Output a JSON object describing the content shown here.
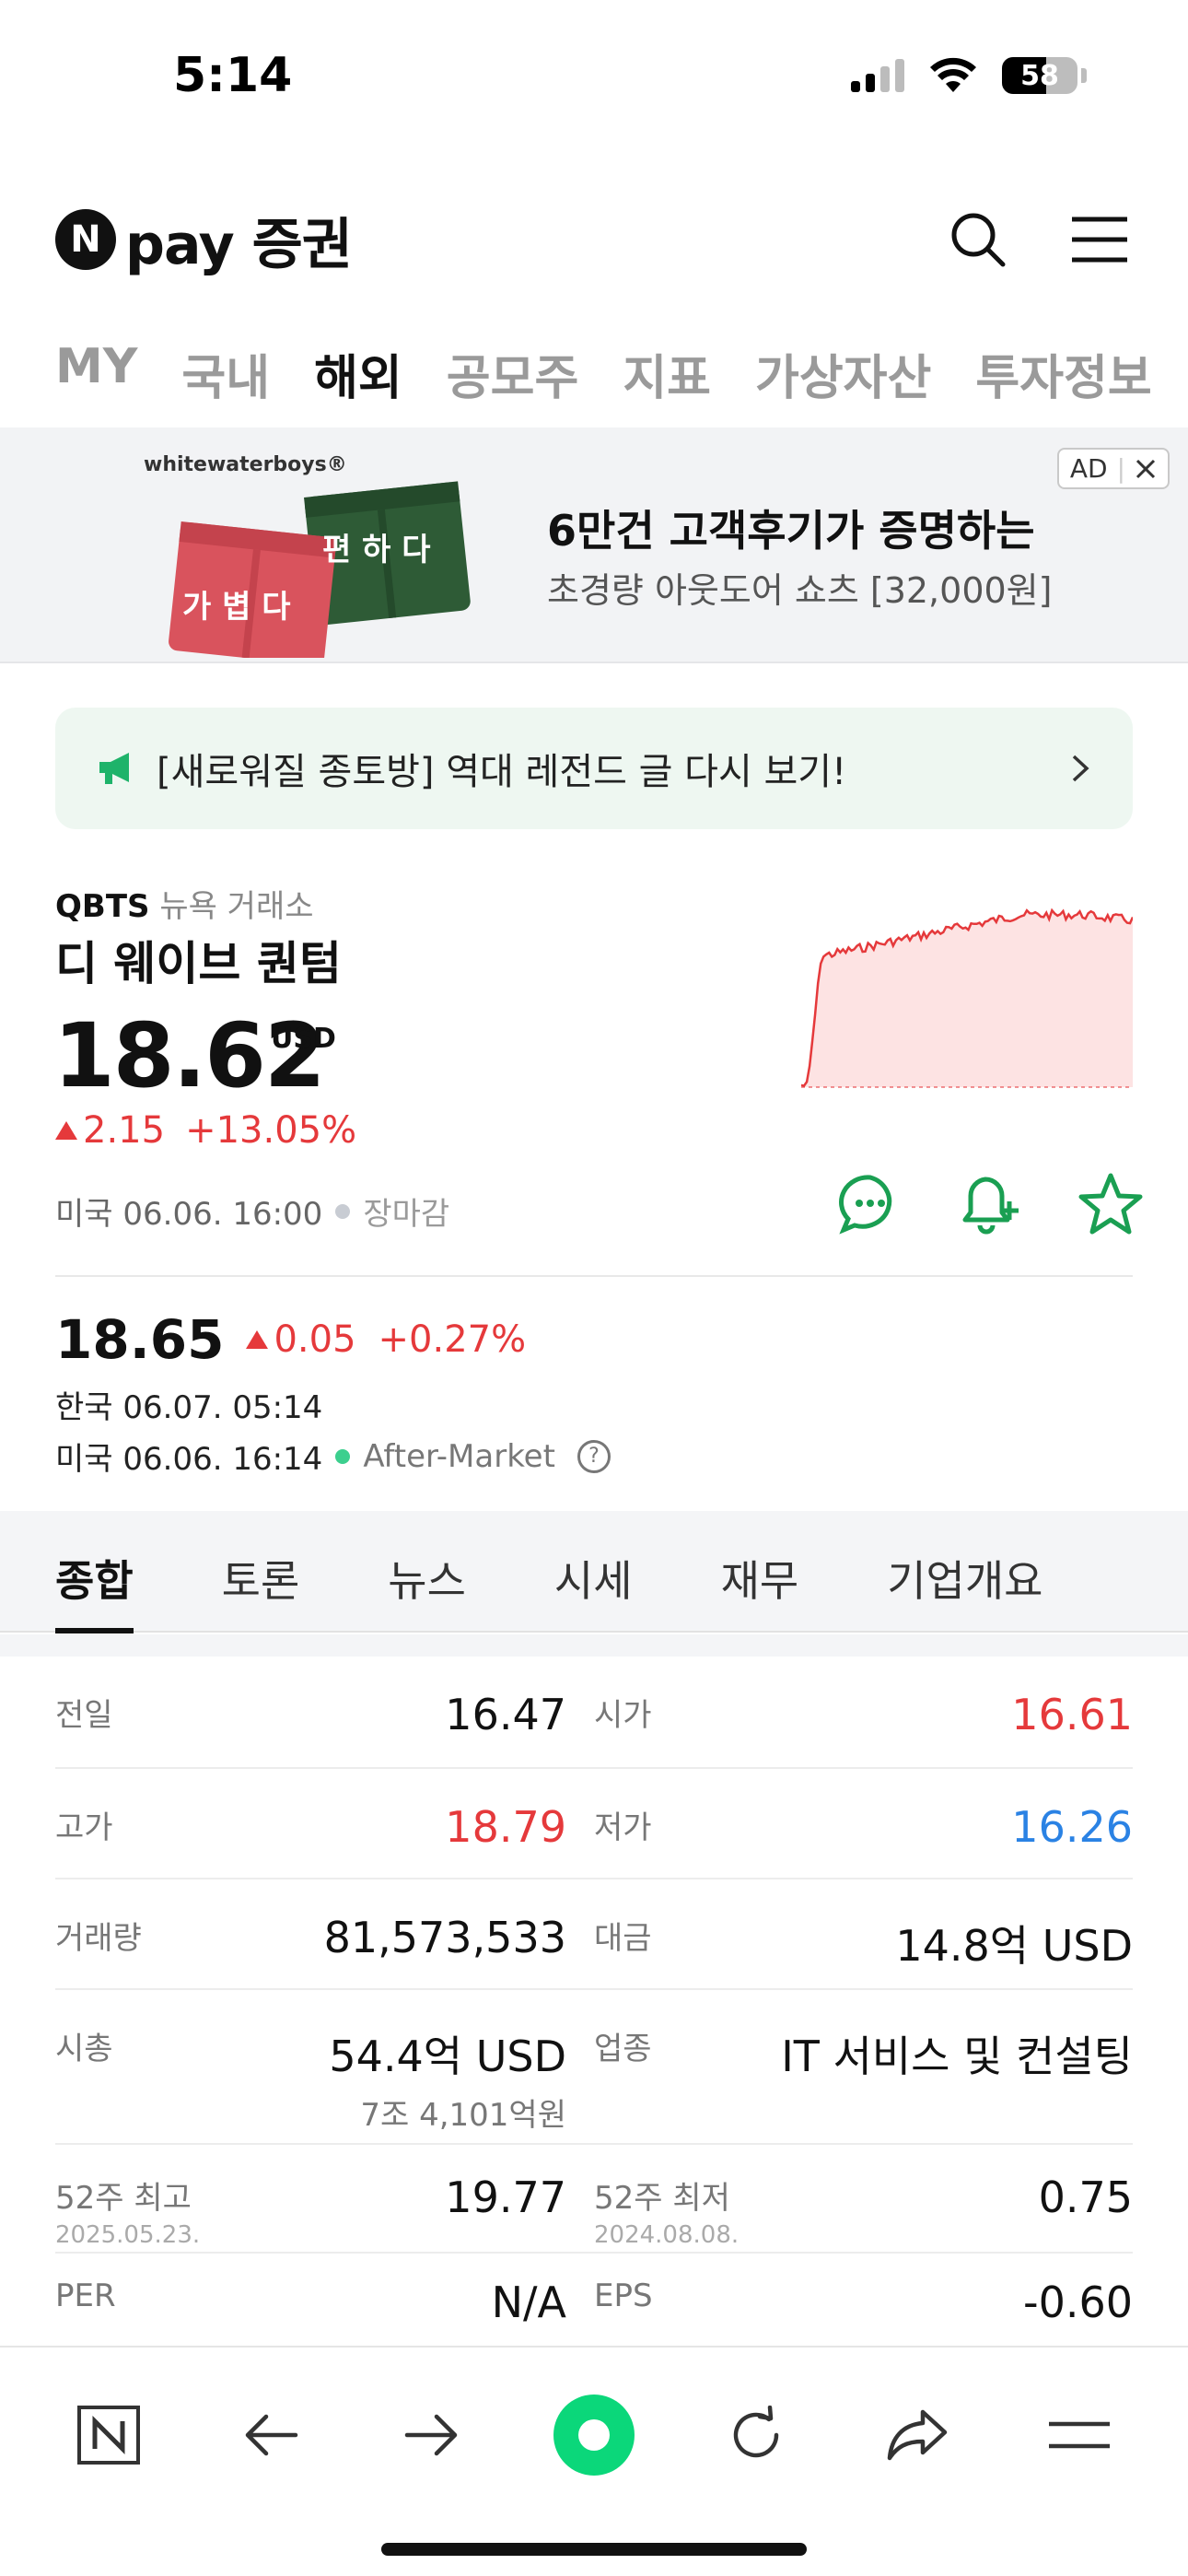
{
  "status": {
    "time": "5:14",
    "battery": "58"
  },
  "header": {
    "logo_letter": "N",
    "logo_text": "pay 증권"
  },
  "topnav": [
    "MY",
    "국내",
    "해외",
    "공모주",
    "지표",
    "가상자산",
    "투자정보"
  ],
  "ad": {
    "brand": "whitewaterboys®",
    "img_text_green": "편 하 다",
    "img_text_red": "가 볍 다",
    "title": "6만건 고객후기가 증명하는",
    "subtitle": "초경량 아웃도어 쇼츠  [32,000원]",
    "badge": "AD"
  },
  "notice": {
    "text": "[새로워질 종토방] 역대 레전드 글 다시 보기!"
  },
  "stock": {
    "ticker": "QBTS",
    "exchange": "뉴욕 거래소",
    "name": "디 웨이브 퀀텀",
    "price": "18.62",
    "currency": "USD",
    "change": "2.15",
    "change_pct": "+13.05%",
    "market_time": "미국 06.06. 16:00",
    "market_status": "장마감"
  },
  "after": {
    "price": "18.65",
    "change": "0.05",
    "change_pct": "+0.27%",
    "kr_time": "한국 06.07. 05:14",
    "us_time": "미국 06.06. 16:14",
    "session": "After-Market",
    "help": "?"
  },
  "subtabs": [
    "종합",
    "토론",
    "뉴스",
    "시세",
    "재무",
    "기업개요"
  ],
  "stats": {
    "rows": [
      [
        {
          "label": "전일",
          "value": "16.47"
        },
        {
          "label": "시가",
          "value": "16.61"
        }
      ],
      [
        {
          "label": "고가",
          "value": "18.79"
        },
        {
          "label": "저가",
          "value": "16.26"
        }
      ],
      [
        {
          "label": "거래량",
          "value": "81,573,533"
        },
        {
          "label": "대금",
          "value": "14.8억 USD"
        }
      ],
      [
        {
          "label": "시총",
          "value": "54.4억 USD",
          "sub": "7조 4,101억원"
        },
        {
          "label": "업종",
          "value": "IT 서비스 및 컨설팅"
        }
      ],
      [
        {
          "label": "52주 최고",
          "date": "2025.05.23.",
          "value": "19.77"
        },
        {
          "label": "52주 최저",
          "date": "2024.08.08.",
          "value": "0.75"
        }
      ],
      [
        {
          "label": "PER",
          "value": "N/A"
        },
        {
          "label": "EPS",
          "value": "-0.60"
        }
      ]
    ]
  },
  "colors": {
    "up": "#e5393b",
    "down": "#2a82e4",
    "brand_green": "#03c75a"
  },
  "icons": [
    "search-icon",
    "menu-icon",
    "megaphone-icon",
    "chevron-right-icon",
    "chat-icon",
    "bell-plus-icon",
    "star-icon",
    "n-home-icon",
    "back-arrow-icon",
    "forward-arrow-icon",
    "green-dot-icon",
    "refresh-icon",
    "share-icon",
    "hamburger-icon"
  ]
}
